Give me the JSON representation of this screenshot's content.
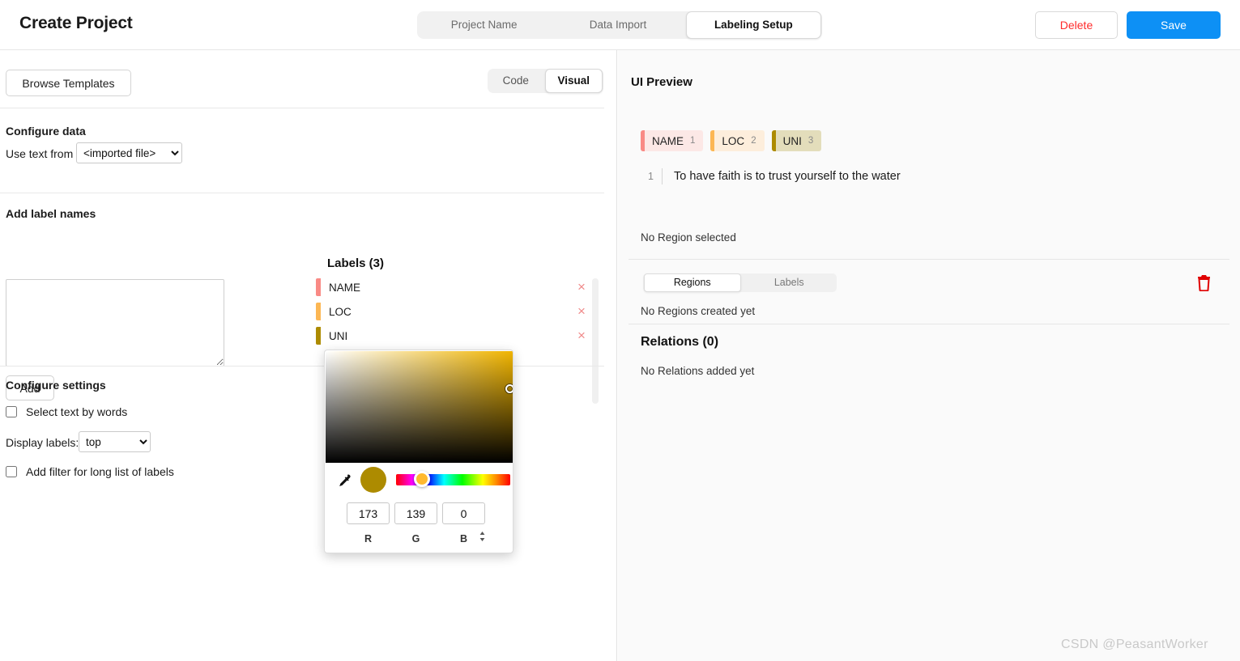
{
  "header": {
    "app_title": "Create Project",
    "steps": [
      {
        "label": "Project Name",
        "active": false
      },
      {
        "label": "Data Import",
        "active": false
      },
      {
        "label": "Labeling Setup",
        "active": true
      }
    ],
    "delete_label": "Delete",
    "save_label": "Save",
    "delete_color": "#ff2b2b",
    "save_bg": "#0d90f5"
  },
  "left": {
    "browse_templates_label": "Browse Templates",
    "editor_modes": [
      {
        "label": "Code",
        "active": false
      },
      {
        "label": "Visual",
        "active": true
      }
    ],
    "configure_data": {
      "title": "Configure data",
      "use_text_from_label": "Use text from",
      "use_text_from_value": "<imported file>",
      "use_text_from_options": [
        "<imported file>"
      ]
    },
    "add_label_names": {
      "title": "Add label names",
      "textarea_value": "",
      "textarea_placeholder": "",
      "add_button_label": "Add"
    },
    "labels_panel": {
      "title": "Labels (3)",
      "remove_icon": "×",
      "items": [
        {
          "name": "NAME",
          "bar_color": "#f98a85",
          "bg_color": "#fce8e6"
        },
        {
          "name": "LOC",
          "bar_color": "#fcb754",
          "bg_color": "#fdeedc"
        },
        {
          "name": "UNI",
          "bar_color": "#ad8b00",
          "bg_color": "#dfd9b3"
        }
      ]
    },
    "color_picker": {
      "base_color": "#ad8b00",
      "r_value": "173",
      "g_value": "139",
      "b_value": "0",
      "r_label": "R",
      "g_label": "G",
      "b_label": "B",
      "stepper_glyph": "⇅",
      "eyedropper_icon": "eyedropper-icon"
    },
    "configure_settings": {
      "title": "Configure settings",
      "select_text_by_words_label": "Select text by words",
      "select_text_by_words_checked": false,
      "display_labels_label": "Display labels:",
      "display_labels_value": "top",
      "display_labels_options": [
        "top"
      ],
      "add_filter_label": "Add filter for long list of labels",
      "add_filter_checked": false
    }
  },
  "right": {
    "title": "UI Preview",
    "tags": [
      {
        "name": "NAME",
        "number": "1",
        "bar_color": "#f98a85",
        "bg_color": "#fce8e6"
      },
      {
        "name": "LOC",
        "number": "2",
        "bar_color": "#fcb754",
        "bg_color": "#fdeedc"
      },
      {
        "name": "UNI",
        "number": "3",
        "bar_color": "#ad8b00",
        "bg_color": "#e3ddbb"
      }
    ],
    "sample_line_number": "1",
    "sample_text": "To have faith is to trust yourself to the water",
    "no_region_selected": "No Region selected",
    "region_tabs": [
      {
        "label": "Regions",
        "active": true
      },
      {
        "label": "Labels",
        "active": false
      }
    ],
    "trash_icon": "trash-icon",
    "trash_color": "#e00000",
    "no_regions_created": "No Regions created yet",
    "relations_title": "Relations (0)",
    "no_relations_added": "No Relations added yet"
  },
  "watermark": "CSDN @PeasantWorker"
}
